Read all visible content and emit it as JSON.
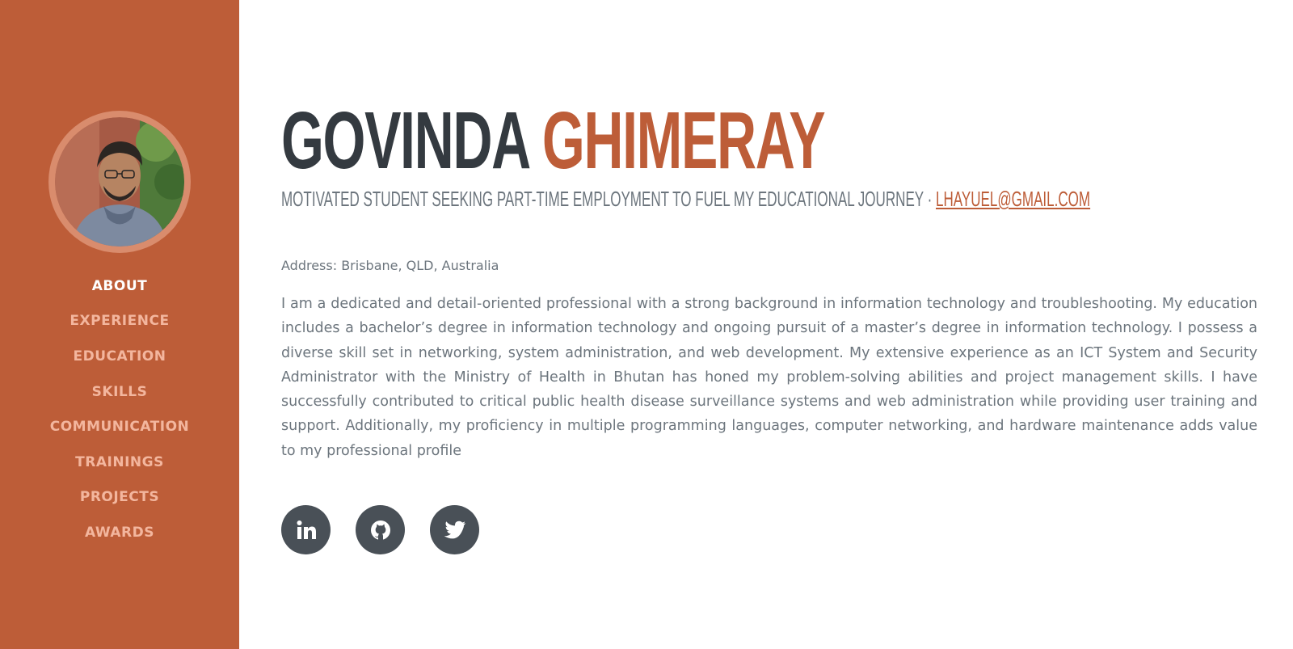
{
  "sidebar": {
    "nav": [
      {
        "label": "ABOUT",
        "active": true
      },
      {
        "label": "EXPERIENCE"
      },
      {
        "label": "EDUCATION"
      },
      {
        "label": "SKILLS"
      },
      {
        "label": "COMMUNICATION"
      },
      {
        "label": "TRAININGS"
      },
      {
        "label": "PROJECTS"
      },
      {
        "label": "AWARDS"
      }
    ]
  },
  "about": {
    "first_name": "GOVINDA",
    "last_name": "GHIMERAY",
    "subheading": "MOTIVATED STUDENT SEEKING PART-TIME EMPLOYMENT TO FUEL MY EDUCATIONAL JOURNEY · ",
    "email": "LHAYUEL@GMAIL.COM",
    "address": "Address: Brisbane, QLD, Australia",
    "summary": "I am a dedicated and detail-oriented professional with a strong background in information technology and troubleshooting. My education includes a bachelor’s degree in information technology and ongoing pursuit of a master’s degree in information technology. I possess a diverse skill set in networking, system administration, and web development. My extensive experience as an ICT System and Security Administrator with the Ministry of Health in Bhutan has honed my problem-solving abilities and project management skills. I have successfully contributed to critical public health disease surveillance systems and web administration while providing user training and support. Additionally, my proficiency in multiple programming languages, computer networking, and hardware maintenance adds value to my professional profile"
  },
  "social": [
    {
      "icon": "linkedin-icon"
    },
    {
      "icon": "github-icon"
    },
    {
      "icon": "twitter-icon"
    }
  ],
  "colors": {
    "accent": "#bd5d38",
    "nav_inactive": "#f3b69e",
    "heading": "#343a40",
    "text": "#6c757d",
    "social_bg": "#495057"
  }
}
